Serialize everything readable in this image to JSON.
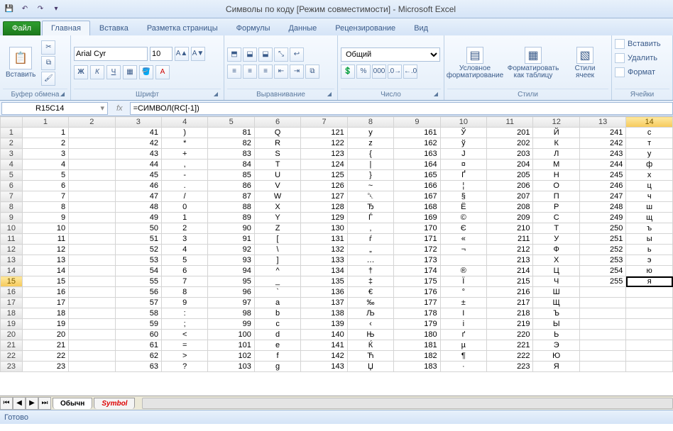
{
  "title": "Символы по коду  [Режим совместимости]  -  Microsoft Excel",
  "file_tab": "Файл",
  "tabs": [
    "Главная",
    "Вставка",
    "Разметка страницы",
    "Формулы",
    "Данные",
    "Рецензирование",
    "Вид"
  ],
  "active_tab": 0,
  "ribbon": {
    "clipboard": {
      "paste": "Вставить",
      "label": "Буфер обмена"
    },
    "font": {
      "name": "Arial Cyr",
      "size": "10",
      "bold": "Ж",
      "italic": "К",
      "underline": "Ч",
      "label": "Шрифт"
    },
    "align": {
      "label": "Выравнивание"
    },
    "number": {
      "format": "Общий",
      "label": "Число"
    },
    "styles": {
      "cond": "Условное форматирование",
      "table": "Форматировать как таблицу",
      "cell": "Стили ячеек",
      "label": "Стили"
    },
    "cells": {
      "insert": "Вставить",
      "delete": "Удалить",
      "format": "Формат",
      "label": "Ячейки"
    }
  },
  "namebox": "R15C14",
  "formula": "=СИМВОЛ(RC[-1])",
  "status": "Готово",
  "sheet_tabs": [
    "Обычн",
    "Symbol"
  ],
  "active_sheet": 0,
  "columns": [
    "1",
    "2",
    "3",
    "4",
    "5",
    "6",
    "7",
    "8",
    "9",
    "10",
    "11",
    "12",
    "13",
    "14"
  ],
  "rows": [
    "1",
    "2",
    "3",
    "4",
    "5",
    "6",
    "7",
    "8",
    "9",
    "10",
    "11",
    "12",
    "13",
    "14",
    "15",
    "16",
    "17",
    "18",
    "19",
    "20",
    "21",
    "22",
    "23"
  ],
  "active_cell": {
    "row": 15,
    "col": 14
  },
  "cells": [
    [
      "1",
      "",
      "41",
      ")",
      "81",
      "Q",
      "121",
      "y",
      "161",
      "Ў",
      "201",
      "Й",
      "241",
      "с"
    ],
    [
      "2",
      "",
      "42",
      "*",
      "82",
      "R",
      "122",
      "z",
      "162",
      "ў",
      "202",
      "К",
      "242",
      "т"
    ],
    [
      "3",
      "",
      "43",
      "+",
      "83",
      "S",
      "123",
      "{",
      "163",
      "J",
      "203",
      "Л",
      "243",
      "у"
    ],
    [
      "4",
      "",
      "44",
      ",",
      "84",
      "T",
      "124",
      "|",
      "164",
      "¤",
      "204",
      "М",
      "244",
      "ф"
    ],
    [
      "5",
      "",
      "45",
      "-",
      "85",
      "U",
      "125",
      "}",
      "165",
      "Ґ",
      "205",
      "Н",
      "245",
      "х"
    ],
    [
      "6",
      "",
      "46",
      ".",
      "86",
      "V",
      "126",
      "~",
      "166",
      "¦",
      "206",
      "О",
      "246",
      "ц"
    ],
    [
      "7",
      "",
      "47",
      "/",
      "87",
      "W",
      "127",
      "␡",
      "167",
      "§",
      "207",
      "П",
      "247",
      "ч"
    ],
    [
      "8",
      "",
      "48",
      "0",
      "88",
      "X",
      "128",
      "Ђ",
      "168",
      "Ё",
      "208",
      "Р",
      "248",
      "ш"
    ],
    [
      "9",
      "",
      "49",
      "1",
      "89",
      "Y",
      "129",
      "Ѓ",
      "169",
      "©",
      "209",
      "С",
      "249",
      "щ"
    ],
    [
      "10",
      "",
      "50",
      "2",
      "90",
      "Z",
      "130",
      "‚",
      "170",
      "Є",
      "210",
      "Т",
      "250",
      "ъ"
    ],
    [
      "11",
      "",
      "51",
      "3",
      "91",
      "[",
      "131",
      "ѓ",
      "171",
      "«",
      "211",
      "У",
      "251",
      "ы"
    ],
    [
      "12",
      "",
      "52",
      "4",
      "92",
      "\\",
      "132",
      "„",
      "172",
      "¬",
      "212",
      "Ф",
      "252",
      "ь"
    ],
    [
      "13",
      "",
      "53",
      "5",
      "93",
      "]",
      "133",
      "…",
      "173",
      "­",
      "213",
      "Х",
      "253",
      "э"
    ],
    [
      "14",
      "",
      "54",
      "6",
      "94",
      "^",
      "134",
      "†",
      "174",
      "®",
      "214",
      "Ц",
      "254",
      "ю"
    ],
    [
      "15",
      "",
      "55",
      "7",
      "95",
      "_",
      "135",
      "‡",
      "175",
      "Ї",
      "215",
      "Ч",
      "255",
      "я"
    ],
    [
      "16",
      "",
      "56",
      "8",
      "96",
      "`",
      "136",
      "€",
      "176",
      "°",
      "216",
      "Ш",
      "",
      ""
    ],
    [
      "17",
      "",
      "57",
      "9",
      "97",
      "a",
      "137",
      "‰",
      "177",
      "±",
      "217",
      "Щ",
      "",
      ""
    ],
    [
      "18",
      "",
      "58",
      ":",
      "98",
      "b",
      "138",
      "Љ",
      "178",
      "І",
      "218",
      "Ъ",
      "",
      ""
    ],
    [
      "19",
      "",
      "59",
      ";",
      "99",
      "c",
      "139",
      "‹",
      "179",
      "і",
      "219",
      "Ы",
      "",
      ""
    ],
    [
      "20",
      "",
      "60",
      "<",
      "100",
      "d",
      "140",
      "Њ",
      "180",
      "ґ",
      "220",
      "Ь",
      "",
      ""
    ],
    [
      "21",
      "",
      "61",
      "=",
      "101",
      "e",
      "141",
      "Ќ",
      "181",
      "µ",
      "221",
      "Э",
      "",
      ""
    ],
    [
      "22",
      "",
      "62",
      ">",
      "102",
      "f",
      "142",
      "Ћ",
      "182",
      "¶",
      "222",
      "Ю",
      "",
      ""
    ],
    [
      "23",
      "",
      "63",
      "?",
      "103",
      "g",
      "143",
      "Џ",
      "183",
      "·",
      "223",
      "Я",
      "",
      ""
    ]
  ]
}
